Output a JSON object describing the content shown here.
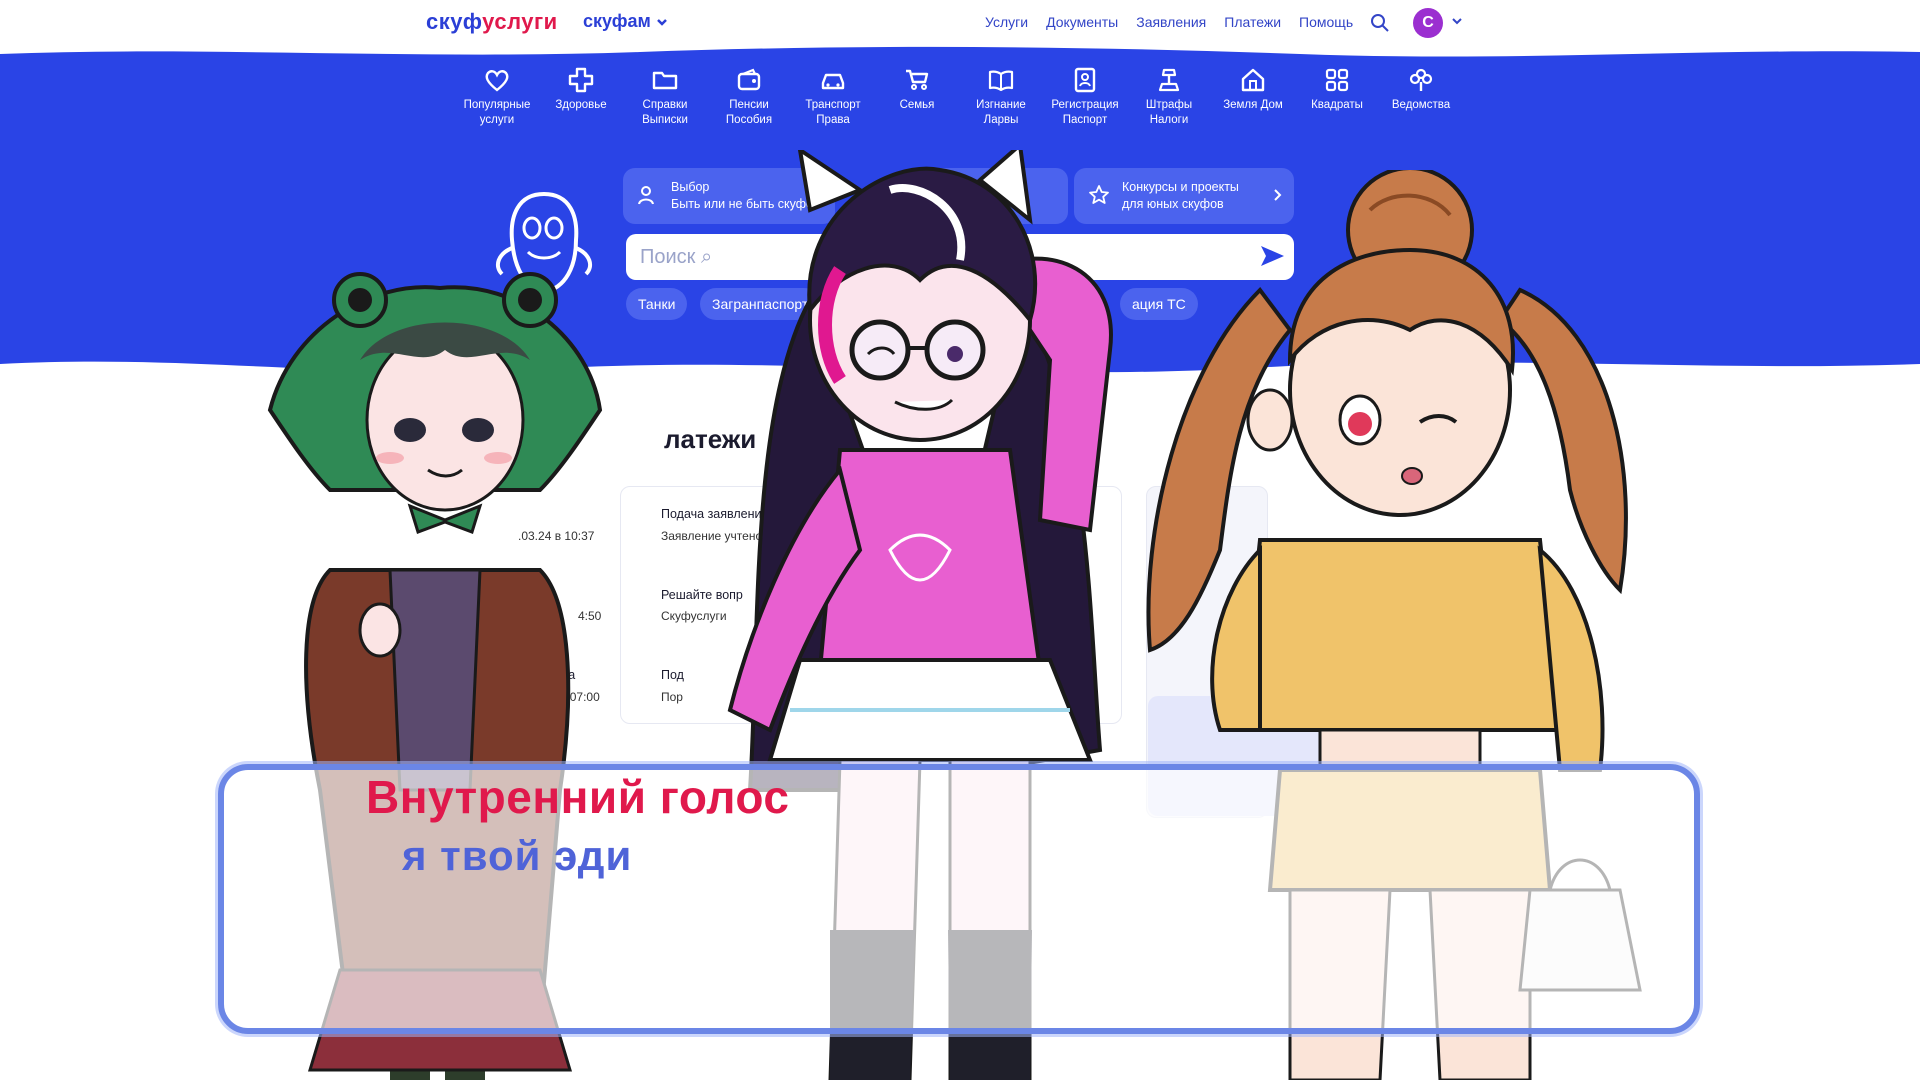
{
  "site": {
    "logo_part1": "скуф",
    "logo_part2": "услуги",
    "logo_alt": "скуфам",
    "nav": [
      "Услуги",
      "Документы",
      "Заявления",
      "Платежи",
      "Помощь"
    ],
    "avatar_letter": "С"
  },
  "categories": [
    {
      "label": "Популярные\nуслуги",
      "icon": "heart-icon"
    },
    {
      "label": "Здоровье",
      "icon": "cross-icon"
    },
    {
      "label": "Справки\nВыписки",
      "icon": "folder-icon"
    },
    {
      "label": "Пенсии\nПособия",
      "icon": "wallet-icon"
    },
    {
      "label": "Транспорт\nПрава",
      "icon": "car-icon"
    },
    {
      "label": "Семья",
      "icon": "stroller-icon"
    },
    {
      "label": "Изгнание\nЛарвы",
      "icon": "book-icon"
    },
    {
      "label": "Регистрация\nПаспорт",
      "icon": "id-card-icon"
    },
    {
      "label": "Штрафы\nНалоги",
      "icon": "gavel-icon"
    },
    {
      "label": "Земля Дом",
      "icon": "house-icon"
    },
    {
      "label": "Квадраты",
      "icon": "grid-icon"
    },
    {
      "label": "Ведомства",
      "icon": "flower-icon"
    }
  ],
  "cards": {
    "choice_title": "Выбор",
    "choice_sub": "Быть или не быть скуфом",
    "contest_title": "Конкурсы и проекты",
    "contest_sub": "для юных скуфов"
  },
  "search": {
    "placeholder": "Поиск ⌕",
    "chips": [
      "Танки",
      "Загранпаспорт",
      "ация ТС"
    ]
  },
  "payments": {
    "heading": "латежи",
    "rows": [
      {
        "title": "Подача заявления о заме",
        "sub": "Заявление учтено",
        "date": ".03.24 в 10:37"
      },
      {
        "title": "Решайте вопр",
        "sub": "Скуфуслуги",
        "date": "4:50"
      },
      {
        "title": "Под",
        "sub": "Пор",
        "date": "4 в 07:00",
        "label": "ата"
      }
    ]
  },
  "dialogue": {
    "speaker": "Внутренний голос",
    "text": "я твой эди"
  },
  "colors": {
    "brand_blue": "#2b3fd6",
    "band_blue": "#2a44e6",
    "accent_red": "#e0194c",
    "dialog_border": "#6b86e6"
  }
}
